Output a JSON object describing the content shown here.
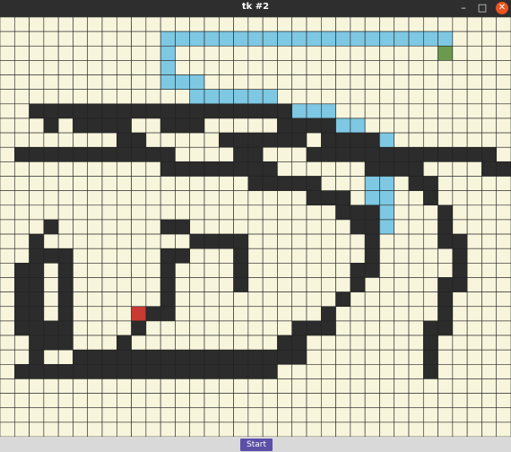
{
  "window": {
    "title": "tk #2",
    "minimize_glyph": "–",
    "maximize_glyph": "□",
    "close_glyph": "✕"
  },
  "controls": {
    "start_label": "Start"
  },
  "grid": {
    "cols": 35,
    "rows": 29,
    "colors": {
      "empty": "#f7f5dc",
      "wall": "#2c2c2c",
      "path": "#7ec8e3",
      "start": "#c93a32",
      "goal": "#6b9a4e",
      "line": "#222222"
    },
    "start_cell": [
      9,
      20
    ],
    "goal_cell": [
      30,
      2
    ],
    "walls": "12:2-16;13:3,16-19;14:3,6,19-21;15:5-8,11-13,20-22;16:8,15-19,22-24;17:9,16-20,23-25;18:10,16-17,21-26;19:1-11,23-33;20:11-15,25-28,33-34;21:16-18,27-28;22:17-20,28-29;23:19-21,28-29;24:21-22,29;25:22-23,29;26:23-24,30;27:23-25,30;28:24-25,30;29:3,11-12,25,30;30:14-15,25,30-31;31:2,13,15,16,25,31;32:3,4,12,16,25,31;33:2,4,11,16,25,31;34:1,4,11,16,25,31;35:1,2,11,16,24,31;36:1,2,4,11,16,24,31;37:1,2,4,11,24,30;38:1,2,4,11,23,30;39:1,2,4,11,23,30;40:1,2,4,11,22,30;41:1,2,4,10,22,30;42:1,2,4,9,21-22,30;43:1,2,3,9,20-21,29;44:2,3,8,19,20,29;45:2,4,8,19,29;46:2,5,6,7,8,13,14,15,16,18,19,20,29;47:9,10,11,12,13,14,15,16,17,18,19,29;48:1-18,29;49:1-18,29",
    "path": "2:11-30;3:11;4:11;5:11;6:11;7:11;8:11;9:11,12,13;10:13,14,15,16;11:16,17,18;12:18,19,20;13:20,21,22;14:22,23;15:23,24;16:24,25;17:25,26;18:25,26;19:25,26;20:25,26;21:25,26;22:25,26;23:25,26;24:25,26;25:25,26;26:25,26;27:25,26;28:25,26;29:24,25,26"
  }
}
